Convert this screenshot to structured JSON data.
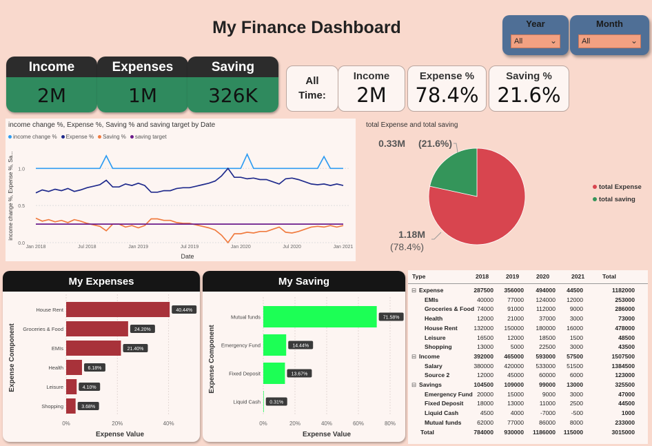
{
  "title": "My Finance Dashboard",
  "slicers": [
    {
      "label": "Year",
      "value": "All"
    },
    {
      "label": "Month",
      "value": "All"
    }
  ],
  "kpis": [
    {
      "label": "Income",
      "value": "2M"
    },
    {
      "label": "Expenses",
      "value": "1M"
    },
    {
      "label": "Saving",
      "value": "326K"
    }
  ],
  "all_time": {
    "label_line1": "All",
    "label_line2": "Time:",
    "cards": [
      {
        "label": "Income",
        "value": "2M"
      },
      {
        "label": "Expense %",
        "value": "78.4%"
      },
      {
        "label": "Saving %",
        "value": "21.6%"
      }
    ]
  },
  "colors": {
    "background": "#f9d9cd",
    "income_line": "#2e9cf2",
    "expense_line": "#1f2a8c",
    "saving_line": "#f07b3f",
    "target_line": "#6b1a8a",
    "pie_expense": "#d8454f",
    "pie_saving": "#34955a",
    "expense_bar": "#a8323a",
    "saving_bar": "#1cff55"
  },
  "chart_data": [
    {
      "type": "line",
      "title": "income change %, Expense %, Saving % and saving target by Date",
      "xlabel": "Date",
      "ylabel": "income change %, Expense %, Sa...",
      "x_ticks": [
        "Jan 2018",
        "Jul 2018",
        "Jan 2019",
        "Jul 2019",
        "Jan 2020",
        "Jul 2020",
        "Jan 2021"
      ],
      "y_ticks": [
        "0.0",
        "0.5",
        "1.0"
      ],
      "ylim": [
        0,
        1.3
      ],
      "grid": true,
      "legend_position": "top-left",
      "series": [
        {
          "name": "income change %",
          "color": "#2e9cf2",
          "values": [
            1.0,
            1.0,
            1.0,
            1.0,
            1.0,
            1.0,
            1.0,
            1.0,
            1.0,
            1.0,
            1.0,
            1.17,
            1.0,
            1.0,
            1.0,
            1.0,
            1.0,
            1.0,
            1.0,
            1.0,
            1.0,
            1.0,
            1.0,
            1.0,
            1.0,
            1.0,
            1.0,
            1.0,
            1.0,
            1.0,
            1.0,
            1.0,
            1.0,
            1.19,
            1.0,
            1.0,
            1.0,
            1.0,
            1.0,
            1.0,
            1.0,
            1.0,
            1.0,
            1.0,
            1.0,
            1.16,
            1.0,
            1.0,
            1.0
          ]
        },
        {
          "name": "Expense %",
          "color": "#1f2a8c",
          "values": [
            0.67,
            0.71,
            0.69,
            0.72,
            0.7,
            0.73,
            0.69,
            0.71,
            0.74,
            0.76,
            0.78,
            0.84,
            0.75,
            0.75,
            0.79,
            0.77,
            0.8,
            0.77,
            0.68,
            0.68,
            0.7,
            0.7,
            0.73,
            0.74,
            0.74,
            0.76,
            0.78,
            0.8,
            0.83,
            0.9,
            1.0,
            0.88,
            0.88,
            0.86,
            0.87,
            0.85,
            0.85,
            0.82,
            0.79,
            0.86,
            0.87,
            0.85,
            0.82,
            0.79,
            0.78,
            0.79,
            0.77,
            0.79,
            0.77
          ]
        },
        {
          "name": "Saving %",
          "color": "#f07b3f",
          "values": [
            0.33,
            0.29,
            0.31,
            0.28,
            0.3,
            0.27,
            0.31,
            0.29,
            0.26,
            0.24,
            0.22,
            0.16,
            0.25,
            0.25,
            0.21,
            0.23,
            0.2,
            0.23,
            0.32,
            0.32,
            0.3,
            0.3,
            0.27,
            0.26,
            0.26,
            0.24,
            0.22,
            0.2,
            0.17,
            0.1,
            0.0,
            0.12,
            0.12,
            0.14,
            0.13,
            0.15,
            0.15,
            0.18,
            0.21,
            0.14,
            0.13,
            0.15,
            0.18,
            0.21,
            0.22,
            0.21,
            0.23,
            0.21,
            0.23
          ]
        },
        {
          "name": "saving target",
          "color": "#6b1a8a",
          "values": [
            0.25,
            0.25,
            0.25,
            0.25,
            0.25,
            0.25,
            0.25,
            0.25,
            0.25,
            0.25,
            0.25,
            0.25,
            0.25,
            0.25,
            0.25,
            0.25,
            0.25,
            0.25,
            0.25,
            0.25,
            0.25,
            0.25,
            0.25,
            0.25,
            0.25,
            0.25,
            0.25,
            0.25,
            0.25,
            0.25,
            0.25,
            0.25,
            0.25,
            0.25,
            0.25,
            0.25,
            0.25,
            0.25,
            0.25,
            0.25,
            0.25,
            0.25,
            0.25,
            0.25,
            0.25,
            0.25,
            0.25,
            0.25,
            0.25
          ]
        }
      ]
    },
    {
      "type": "pie",
      "title": "total Expense and total saving",
      "legend_position": "right",
      "slices": [
        {
          "name": "total Expense",
          "value": 1.18,
          "value_label": "1.18M",
          "pct_label": "(78.4%)",
          "pct": 78.4,
          "color": "#d8454f"
        },
        {
          "name": "total saving",
          "value": 0.33,
          "value_label": "0.33M",
          "pct_label": "(21.6%)",
          "pct": 21.6,
          "color": "#34955a"
        }
      ]
    },
    {
      "type": "bar",
      "title": "My Expenses",
      "orientation": "horizontal",
      "xlabel": "Expense Value",
      "ylabel": "Expense Component",
      "x_ticks": [
        "0%",
        "20%",
        "40%"
      ],
      "xlim": [
        0,
        42
      ],
      "categories": [
        "House Rent",
        "Groceries & Food",
        "EMIs",
        "Health",
        "Leisure",
        "Shopping"
      ],
      "values": [
        40.44,
        24.2,
        21.4,
        6.18,
        4.1,
        3.68
      ],
      "value_labels": [
        "40.44%",
        "24.20%",
        "21.40%",
        "6.18%",
        "4.10%",
        "3.68%"
      ]
    },
    {
      "type": "bar",
      "title": "My Saving",
      "orientation": "horizontal",
      "xlabel": "Expense Value",
      "ylabel": "Expense Component",
      "x_ticks": [
        "0%",
        "20%",
        "40%",
        "60%",
        "80%"
      ],
      "xlim": [
        0,
        80
      ],
      "categories": [
        "Mutual funds",
        "Emergency Fund",
        "Fixed Deposit",
        "Liquid Cash"
      ],
      "values": [
        71.58,
        14.44,
        13.67,
        0.31
      ],
      "value_labels": [
        "71.58%",
        "14.44%",
        "13.67%",
        "0.31%"
      ]
    },
    {
      "type": "table",
      "columns": [
        "Type",
        "2018",
        "2019",
        "2020",
        "2021",
        "Total"
      ],
      "rows": [
        {
          "level": 0,
          "expander": "⊟",
          "label": "Expense",
          "values": [
            "287500",
            "356000",
            "494000",
            "44500",
            "1182000"
          ]
        },
        {
          "level": 1,
          "label": "EMIs",
          "values": [
            "40000",
            "77000",
            "124000",
            "12000",
            "253000"
          ]
        },
        {
          "level": 1,
          "label": "Groceries & Food",
          "values": [
            "74000",
            "91000",
            "112000",
            "9000",
            "286000"
          ]
        },
        {
          "level": 1,
          "label": "Health",
          "values": [
            "12000",
            "21000",
            "37000",
            "3000",
            "73000"
          ]
        },
        {
          "level": 1,
          "label": "House Rent",
          "values": [
            "132000",
            "150000",
            "180000",
            "16000",
            "478000"
          ]
        },
        {
          "level": 1,
          "label": "Leisure",
          "values": [
            "16500",
            "12000",
            "18500",
            "1500",
            "48500"
          ]
        },
        {
          "level": 1,
          "label": "Shopping",
          "values": [
            "13000",
            "5000",
            "22500",
            "3000",
            "43500"
          ]
        },
        {
          "level": 0,
          "expander": "⊟",
          "label": "Income",
          "values": [
            "392000",
            "465000",
            "593000",
            "57500",
            "1507500"
          ]
        },
        {
          "level": 1,
          "label": "Salary",
          "values": [
            "380000",
            "420000",
            "533000",
            "51500",
            "1384500"
          ]
        },
        {
          "level": 1,
          "label": "Source 2",
          "values": [
            "12000",
            "45000",
            "60000",
            "6000",
            "123000"
          ]
        },
        {
          "level": 0,
          "expander": "⊟",
          "label": "Savings",
          "values": [
            "104500",
            "109000",
            "99000",
            "13000",
            "325500"
          ]
        },
        {
          "level": 1,
          "label": "Emergency Fund",
          "values": [
            "20000",
            "15000",
            "9000",
            "3000",
            "47000"
          ]
        },
        {
          "level": 1,
          "label": "Fixed Deposit",
          "values": [
            "18000",
            "13000",
            "11000",
            "2500",
            "44500"
          ]
        },
        {
          "level": 1,
          "label": "Liquid Cash",
          "values": [
            "4500",
            "4000",
            "-7000",
            "-500",
            "1000"
          ]
        },
        {
          "level": 1,
          "label": "Mutual funds",
          "values": [
            "62000",
            "77000",
            "86000",
            "8000",
            "233000"
          ]
        },
        {
          "level": 0,
          "label": "Total",
          "values": [
            "784000",
            "930000",
            "1186000",
            "115000",
            "3015000"
          ]
        }
      ]
    }
  ]
}
